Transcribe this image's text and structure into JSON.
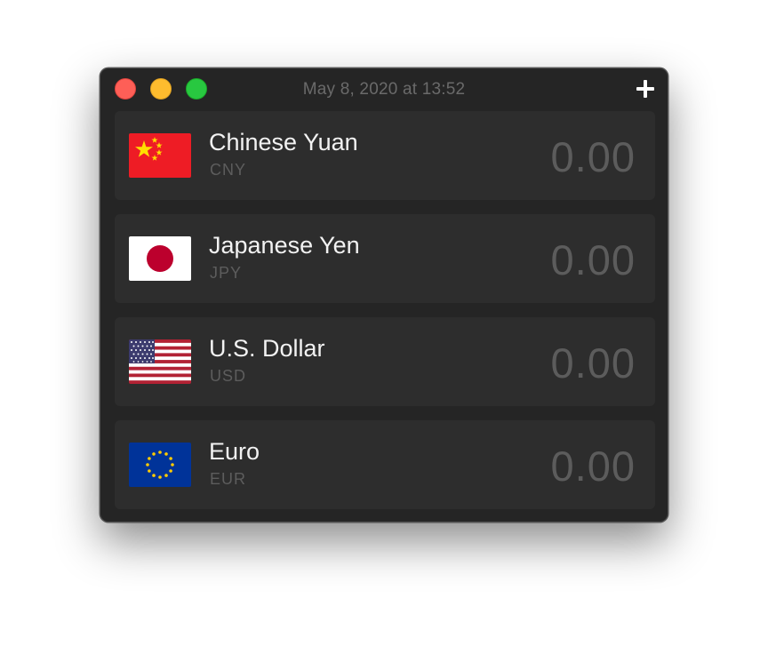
{
  "window": {
    "title": "May 8, 2020 at 13:52"
  },
  "toolbar": {
    "add_icon": "plus-icon"
  },
  "currencies": [
    {
      "name": "Chinese Yuan",
      "code": "CNY",
      "value": "0.00",
      "flag": "china-flag-icon"
    },
    {
      "name": "Japanese Yen",
      "code": "JPY",
      "value": "0.00",
      "flag": "japan-flag-icon"
    },
    {
      "name": "U.S. Dollar",
      "code": "USD",
      "value": "0.00",
      "flag": "usa-flag-icon"
    },
    {
      "name": "Euro",
      "code": "EUR",
      "value": "0.00",
      "flag": "eu-flag-icon"
    }
  ],
  "colors": {
    "window_bg": "#252525",
    "row_bg": "#2d2d2d",
    "close": "#fe5f57",
    "minimize": "#febc2e",
    "maximize": "#28c840"
  }
}
